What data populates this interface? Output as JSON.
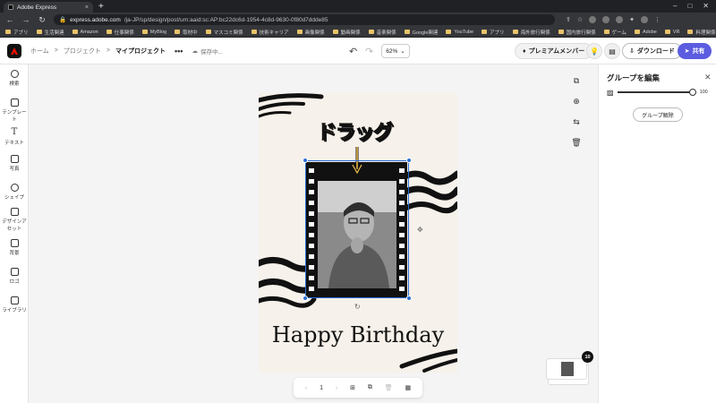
{
  "browser": {
    "tab_title": "Adobe Express",
    "tab_close": "×",
    "new_tab": "+",
    "url_host": "express.adobe.com",
    "url_path": "/ja-JP/sp/design/post/urn:aaid:sc:AP:bc22dc6d-1954-4c8d-9630-0f80d7ddde85",
    "window_controls": [
      "–",
      "□",
      "✕"
    ],
    "bookmarks": [
      "アプリ",
      "生活関連",
      "Amazon",
      "仕事関係",
      "MyBlog",
      "取材中",
      "マスコミ関係",
      "技術キャリア",
      "画像関係",
      "動画関係",
      "音楽関係",
      "Google関連",
      "YouTube",
      "アプリ",
      "海外旅行関係",
      "国内旅行関係",
      "ゲーム",
      "Adobe",
      "VR",
      "料理関係",
      "AI"
    ]
  },
  "header": {
    "breadcrumb": [
      "ホーム",
      "プロジェクト",
      "マイプロジェクト"
    ],
    "breadcrumb_sep": ">",
    "more": "•••",
    "saving": "保存中...",
    "zoom": "62%",
    "premium_label": "プレミアムメンバー",
    "download_label": "ダウンロード",
    "share_label": "共有"
  },
  "left_rail": {
    "items": [
      {
        "label": "検索",
        "icon": "search-icon"
      },
      {
        "label": "テンプレート",
        "icon": "template-icon"
      },
      {
        "label": "テキスト",
        "icon": "text-icon"
      },
      {
        "label": "写真",
        "icon": "photo-icon"
      },
      {
        "label": "シェイプ",
        "icon": "shape-icon"
      },
      {
        "label": "デザインアセット",
        "icon": "design-asset-icon"
      },
      {
        "label": "背景",
        "icon": "background-icon"
      },
      {
        "label": "ロゴ",
        "icon": "logo-icon"
      },
      {
        "label": "ライブラリ",
        "icon": "library-icon"
      }
    ]
  },
  "canvas": {
    "drag_label": "ドラッグ",
    "birthday_text": "Happy Birthday",
    "page_number": "1",
    "thumb_count": "10"
  },
  "right_panel": {
    "title": "グループを編集",
    "close": "✕",
    "opacity_value": "100",
    "opacity_level": 1.0,
    "ungroup_label": "グループ解除"
  },
  "colors": {
    "accent": "#5c5ce0",
    "selection": "#2b6cd4",
    "drag_text": "#f2c14e",
    "card_bg": "#f6f1ea"
  }
}
